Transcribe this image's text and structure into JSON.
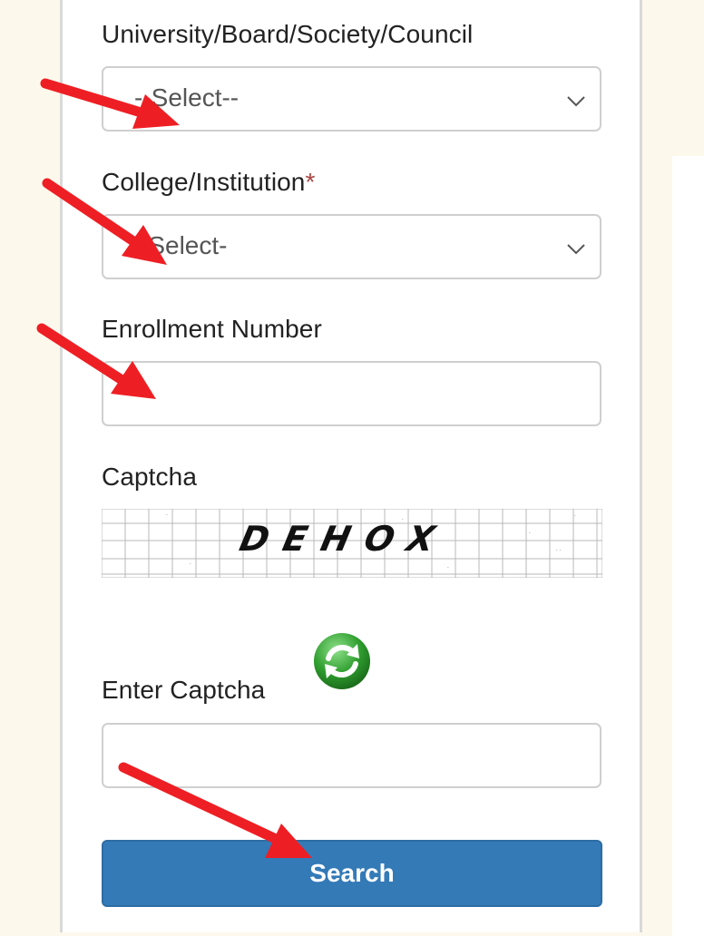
{
  "form": {
    "university": {
      "label": "University/Board/Society/Council",
      "value": "--Select--"
    },
    "college": {
      "label": "College/Institution",
      "required_mark": "*",
      "value": "-Select-"
    },
    "enrollment": {
      "label": "Enrollment Number",
      "value": ""
    },
    "captcha": {
      "label": "Captcha",
      "text": "DEHOX"
    },
    "enter_captcha": {
      "label": "Enter Captcha",
      "value": ""
    },
    "search_button": {
      "label": "Search"
    }
  },
  "icons": {
    "refresh": "refresh-icon",
    "dropdown": "chevron-down-icon",
    "annotation": "red-arrow"
  },
  "colors": {
    "page_background": "#fdf8ec",
    "button": "#337ab7",
    "required": "#a94442",
    "arrow": "#ee1f24",
    "refresh_green": "#2f9e2f"
  }
}
